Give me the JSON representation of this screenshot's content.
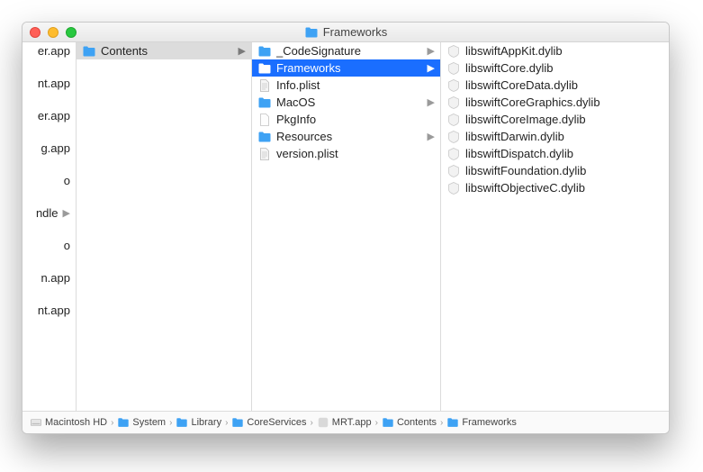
{
  "window": {
    "title": "Frameworks"
  },
  "col0": [
    {
      "name": "er.app",
      "kind": "app"
    },
    {
      "name": "nt.app",
      "kind": "app"
    },
    {
      "name": "er.app",
      "kind": "app"
    },
    {
      "name": "g.app",
      "kind": "app"
    },
    {
      "name": "o",
      "kind": "file"
    },
    {
      "name": "ndle",
      "kind": "bundle",
      "arrow": true
    },
    {
      "name": "o",
      "kind": "file"
    },
    {
      "name": "n.app",
      "kind": "app"
    },
    {
      "name": "nt.app",
      "kind": "app"
    }
  ],
  "col1": [
    {
      "name": "Contents",
      "kind": "folder",
      "arrow": true,
      "selected": "path"
    }
  ],
  "col2": [
    {
      "name": "_CodeSignature",
      "kind": "folder",
      "arrow": true
    },
    {
      "name": "Frameworks",
      "kind": "folder",
      "arrow": true,
      "selected": "focus"
    },
    {
      "name": "Info.plist",
      "kind": "doc"
    },
    {
      "name": "MacOS",
      "kind": "folder",
      "arrow": true
    },
    {
      "name": "PkgInfo",
      "kind": "blank"
    },
    {
      "name": "Resources",
      "kind": "folder",
      "arrow": true
    },
    {
      "name": "version.plist",
      "kind": "doc"
    }
  ],
  "col3": [
    {
      "name": "libswiftAppKit.dylib",
      "kind": "dylib"
    },
    {
      "name": "libswiftCore.dylib",
      "kind": "dylib"
    },
    {
      "name": "libswiftCoreData.dylib",
      "kind": "dylib"
    },
    {
      "name": "libswiftCoreGraphics.dylib",
      "kind": "dylib"
    },
    {
      "name": "libswiftCoreImage.dylib",
      "kind": "dylib"
    },
    {
      "name": "libswiftDarwin.dylib",
      "kind": "dylib"
    },
    {
      "name": "libswiftDispatch.dylib",
      "kind": "dylib"
    },
    {
      "name": "libswiftFoundation.dylib",
      "kind": "dylib"
    },
    {
      "name": "libswiftObjectiveC.dylib",
      "kind": "dylib"
    }
  ],
  "path": [
    {
      "name": "Macintosh HD",
      "kind": "disk"
    },
    {
      "name": "System",
      "kind": "sysfolder"
    },
    {
      "name": "Library",
      "kind": "folder"
    },
    {
      "name": "CoreServices",
      "kind": "folder"
    },
    {
      "name": "MRT.app",
      "kind": "app"
    },
    {
      "name": "Contents",
      "kind": "folder"
    },
    {
      "name": "Frameworks",
      "kind": "folder"
    }
  ],
  "colors": {
    "folder": "#3ea2f4",
    "selection": "#1a6eff"
  }
}
